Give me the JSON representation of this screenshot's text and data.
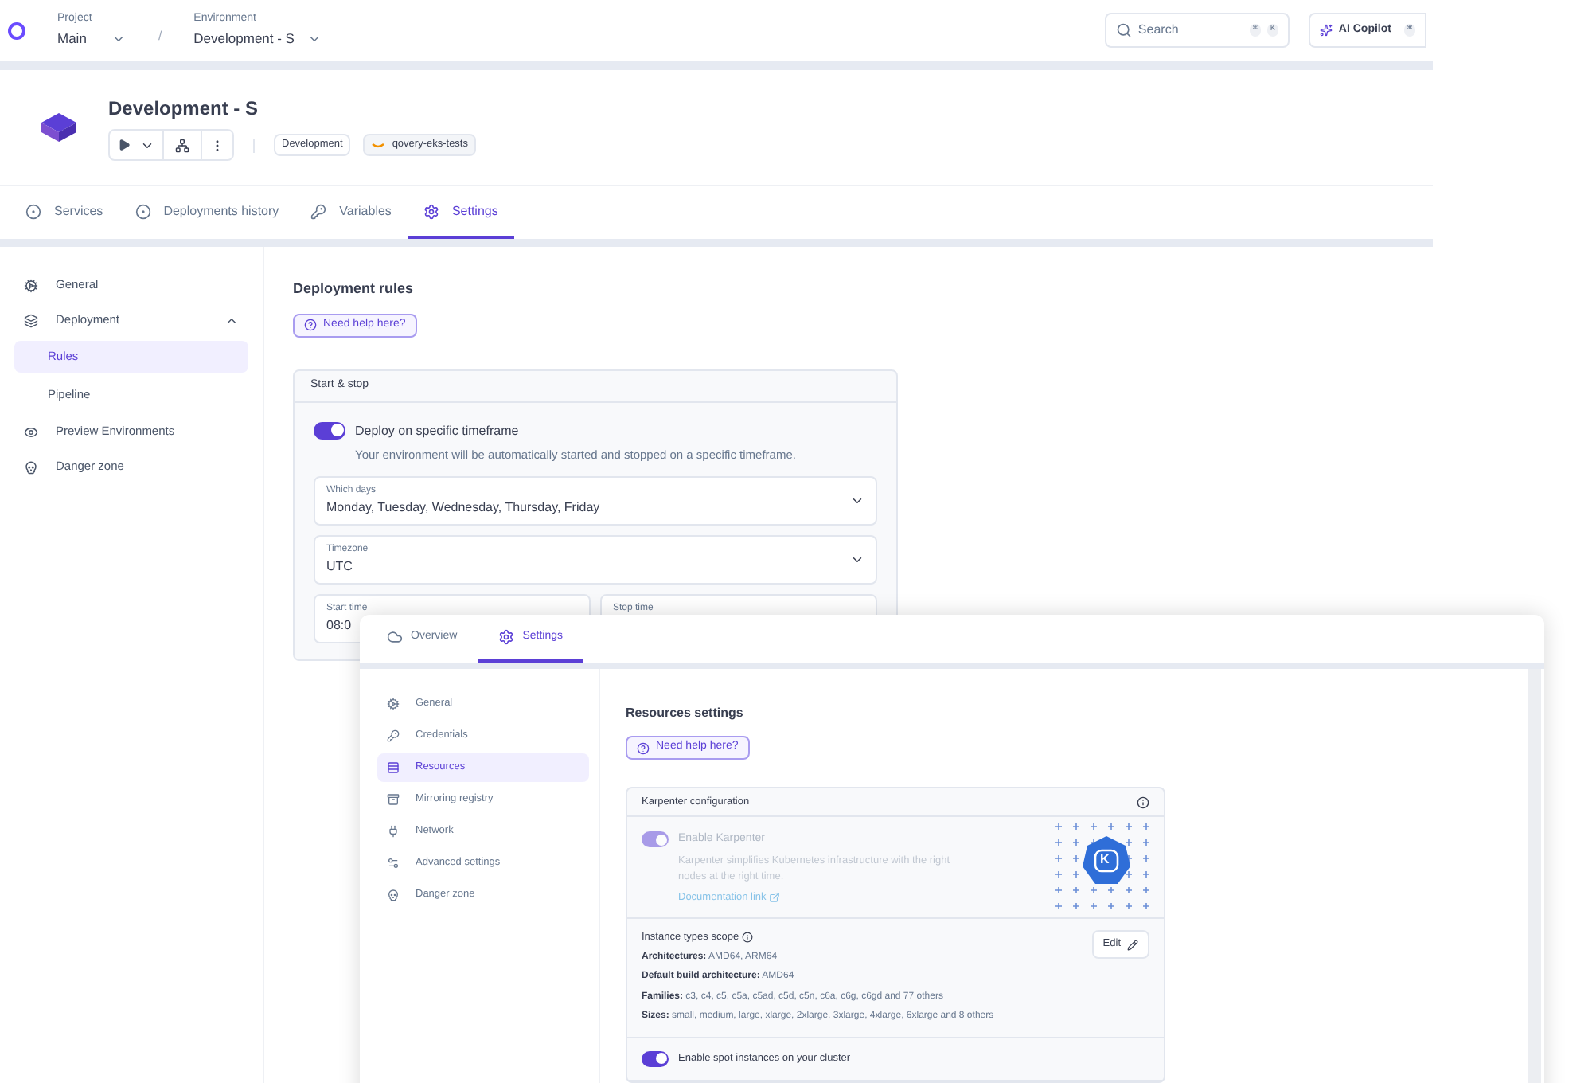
{
  "header": {
    "project": {
      "label": "Project",
      "value": "Main"
    },
    "separator": "/",
    "environment": {
      "label": "Environment",
      "value": "Development - S"
    },
    "search": {
      "placeholder": "Search",
      "keys": [
        "⌘",
        "K"
      ]
    },
    "copilot": {
      "label": "AI Copilot",
      "key": "⌘"
    }
  },
  "environment": {
    "title": "Development - S",
    "tags": [
      {
        "label": "Development",
        "kind": "plain"
      },
      {
        "label": "qovery-eks-tests",
        "kind": "cloud"
      }
    ]
  },
  "tabs": [
    {
      "label": "Services",
      "selected": false
    },
    {
      "label": "Deployments history",
      "selected": false
    },
    {
      "label": "Variables",
      "selected": false
    },
    {
      "label": "Settings",
      "selected": true
    }
  ],
  "sidebar": {
    "items": [
      {
        "label": "General",
        "selected": false
      },
      {
        "label": "Deployment",
        "selected": false,
        "expanded": true,
        "children": [
          {
            "label": "Rules",
            "selected": true
          },
          {
            "label": "Pipeline",
            "selected": false
          }
        ]
      },
      {
        "label": "Preview Environments",
        "selected": false
      },
      {
        "label": "Danger zone",
        "selected": false
      }
    ]
  },
  "content": {
    "title": "Deployment rules",
    "help": "Need help here?",
    "card": {
      "title": "Start & stop",
      "toggle": {
        "label": "Deploy on specific timeframe",
        "description": "Your environment will be automatically started and stopped on a specific timeframe.",
        "on": true
      },
      "selects": [
        {
          "label": "Which days",
          "value": "Monday, Tuesday, Wednesday, Thursday, Friday"
        },
        {
          "label": "Timezone",
          "value": "UTC"
        }
      ],
      "times": [
        {
          "label": "Start time",
          "value": "08:0"
        },
        {
          "label": "Stop time"
        }
      ]
    }
  },
  "overlay": {
    "tabs": [
      {
        "label": "Overview",
        "selected": false
      },
      {
        "label": "Settings",
        "selected": true
      }
    ],
    "sidebar": [
      {
        "label": "General",
        "selected": false
      },
      {
        "label": "Credentials",
        "selected": false
      },
      {
        "label": "Resources",
        "selected": true
      },
      {
        "label": "Mirroring registry",
        "selected": false
      },
      {
        "label": "Network",
        "selected": false
      },
      {
        "label": "Advanced settings",
        "selected": false
      },
      {
        "label": "Danger zone",
        "selected": false
      }
    ],
    "title": "Resources settings",
    "help": "Need help here?",
    "card": {
      "title": "Karpenter configuration",
      "karpenter": {
        "label": "Enable Karpenter",
        "description": "Karpenter simplifies Kubernetes infrastructure with the right nodes at the right time.",
        "on": true,
        "disabled": true,
        "link": "Documentation link",
        "logo_letter": "K"
      },
      "scope": {
        "title": "Instance types scope",
        "edit": "Edit",
        "lines": [
          "**Architectures:** AMD64, ARM64",
          "**Default build architecture:** AMD64",
          "**Families:** c3, c4, c5, c5a, c5ad, c5d, c5n, c6a, c6g, c6gd and 77 others",
          "**Sizes:** small, medium, large, xlarge, 2xlarge, 3xlarge, 4xlarge, 6xlarge and 8 others"
        ]
      },
      "spot": {
        "label": "Enable spot instances on your cluster",
        "on": true
      }
    }
  }
}
